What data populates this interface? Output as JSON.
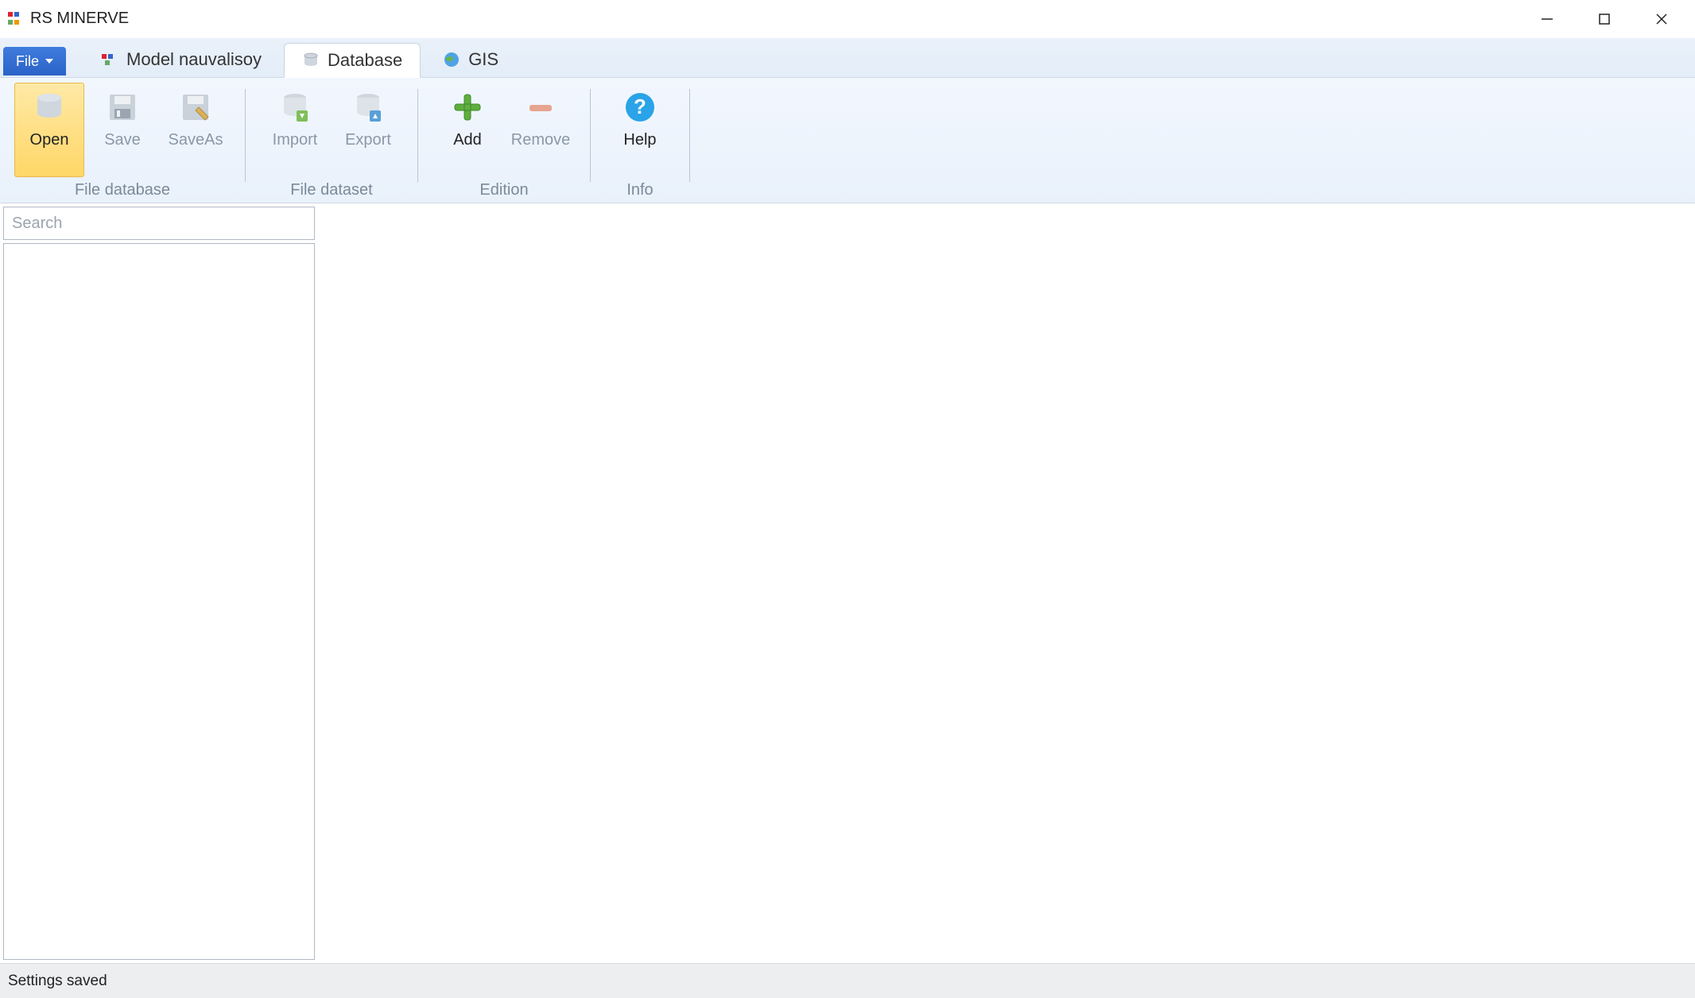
{
  "app": {
    "title": "RS MINERVE"
  },
  "menu": {
    "file_label": "File"
  },
  "tabs": {
    "model": {
      "label": "Model nauvalisoy"
    },
    "database": {
      "label": "Database"
    },
    "gis": {
      "label": "GIS"
    }
  },
  "ribbon": {
    "groups": {
      "file_database": {
        "label": "File database",
        "open": "Open",
        "save": "Save",
        "saveas": "SaveAs"
      },
      "file_dataset": {
        "label": "File dataset",
        "import": "Import",
        "export": "Export"
      },
      "edition": {
        "label": "Edition",
        "add": "Add",
        "remove": "Remove"
      },
      "info": {
        "label": "Info",
        "help": "Help"
      }
    }
  },
  "search": {
    "placeholder": "Search"
  },
  "status": {
    "text": "Settings saved"
  }
}
